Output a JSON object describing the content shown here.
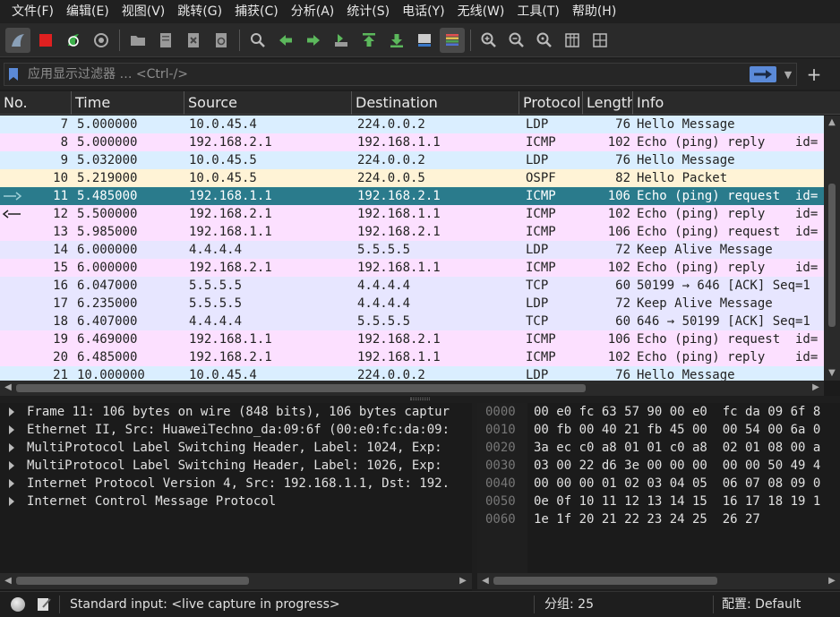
{
  "menu": [
    "文件(F)",
    "编辑(E)",
    "视图(V)",
    "跳转(G)",
    "捕获(C)",
    "分析(A)",
    "统计(S)",
    "电话(Y)",
    "无线(W)",
    "工具(T)",
    "帮助(H)"
  ],
  "toolbar": {
    "icons": [
      "shark-fin-icon",
      "stop-capture-icon",
      "restart-capture-icon",
      "capture-options-icon",
      "open-file-icon",
      "save-file-icon",
      "close-file-icon",
      "reload-file-icon",
      "find-packet-icon",
      "go-back-icon",
      "go-forward-icon",
      "go-to-packet-icon",
      "go-first-icon",
      "go-last-icon",
      "auto-scroll-icon",
      "colorize-icon",
      "zoom-in-icon",
      "zoom-out-icon",
      "zoom-normal-icon",
      "resize-columns-icon",
      "layout-icon"
    ]
  },
  "filter": {
    "placeholder": "应用显示过滤器 … <Ctrl-/>",
    "add_label": "+"
  },
  "columns": [
    "No.",
    "Time",
    "Source",
    "Destination",
    "Protocol",
    "Length",
    "Info"
  ],
  "colors": {
    "udp_blue": "#daeeff",
    "icmp_pink": "#fce0ff",
    "ospf_yellow": "#fff3d6",
    "tcp_gray": "#e7e6ff",
    "selected": "#2a7b8c"
  },
  "packets": [
    {
      "no": "7",
      "time": "5.000000",
      "src": "10.0.45.4",
      "dst": "224.0.0.2",
      "proto": "LDP",
      "len": "76",
      "info": "Hello Message",
      "color": "#daeeff",
      "mark": ""
    },
    {
      "no": "8",
      "time": "5.000000",
      "src": "192.168.2.1",
      "dst": "192.168.1.1",
      "proto": "ICMP",
      "len": "102",
      "info": "Echo (ping) reply    id=",
      "color": "#fce0ff",
      "mark": ""
    },
    {
      "no": "9",
      "time": "5.032000",
      "src": "10.0.45.5",
      "dst": "224.0.0.2",
      "proto": "LDP",
      "len": "76",
      "info": "Hello Message",
      "color": "#daeeff",
      "mark": ""
    },
    {
      "no": "10",
      "time": "5.219000",
      "src": "10.0.45.5",
      "dst": "224.0.0.5",
      "proto": "OSPF",
      "len": "82",
      "info": "Hello Packet",
      "color": "#fff3d6",
      "mark": ""
    },
    {
      "no": "11",
      "time": "5.485000",
      "src": "192.168.1.1",
      "dst": "192.168.2.1",
      "proto": "ICMP",
      "len": "106",
      "info": "Echo (ping) request  id=",
      "color": "#2a7b8c",
      "mark": "request",
      "selected": true
    },
    {
      "no": "12",
      "time": "5.500000",
      "src": "192.168.2.1",
      "dst": "192.168.1.1",
      "proto": "ICMP",
      "len": "102",
      "info": "Echo (ping) reply    id=",
      "color": "#fce0ff",
      "mark": "reply"
    },
    {
      "no": "13",
      "time": "5.985000",
      "src": "192.168.1.1",
      "dst": "192.168.2.1",
      "proto": "ICMP",
      "len": "106",
      "info": "Echo (ping) request  id=",
      "color": "#fce0ff",
      "mark": ""
    },
    {
      "no": "14",
      "time": "6.000000",
      "src": "4.4.4.4",
      "dst": "5.5.5.5",
      "proto": "LDP",
      "len": "72",
      "info": "Keep Alive Message",
      "color": "#e7e6ff",
      "mark": ""
    },
    {
      "no": "15",
      "time": "6.000000",
      "src": "192.168.2.1",
      "dst": "192.168.1.1",
      "proto": "ICMP",
      "len": "102",
      "info": "Echo (ping) reply    id=",
      "color": "#fce0ff",
      "mark": ""
    },
    {
      "no": "16",
      "time": "6.047000",
      "src": "5.5.5.5",
      "dst": "4.4.4.4",
      "proto": "TCP",
      "len": "60",
      "info": "50199 → 646 [ACK] Seq=1",
      "color": "#e7e6ff",
      "mark": ""
    },
    {
      "no": "17",
      "time": "6.235000",
      "src": "5.5.5.5",
      "dst": "4.4.4.4",
      "proto": "LDP",
      "len": "72",
      "info": "Keep Alive Message",
      "color": "#e7e6ff",
      "mark": ""
    },
    {
      "no": "18",
      "time": "6.407000",
      "src": "4.4.4.4",
      "dst": "5.5.5.5",
      "proto": "TCP",
      "len": "60",
      "info": "646 → 50199 [ACK] Seq=1",
      "color": "#e7e6ff",
      "mark": ""
    },
    {
      "no": "19",
      "time": "6.469000",
      "src": "192.168.1.1",
      "dst": "192.168.2.1",
      "proto": "ICMP",
      "len": "106",
      "info": "Echo (ping) request  id=",
      "color": "#fce0ff",
      "mark": ""
    },
    {
      "no": "20",
      "time": "6.485000",
      "src": "192.168.2.1",
      "dst": "192.168.1.1",
      "proto": "ICMP",
      "len": "102",
      "info": "Echo (ping) reply    id=",
      "color": "#fce0ff",
      "mark": ""
    },
    {
      "no": "21",
      "time": "10.000000",
      "src": "10.0.45.4",
      "dst": "224.0.0.2",
      "proto": "LDP",
      "len": "76",
      "info": "Hello Message",
      "color": "#daeeff",
      "mark": ""
    }
  ],
  "details": [
    "Frame 11: 106 bytes on wire (848 bits), 106 bytes captur",
    "Ethernet II, Src: HuaweiTechno_da:09:6f (00:e0:fc:da:09:",
    "MultiProtocol Label Switching Header, Label: 1024, Exp: ",
    "MultiProtocol Label Switching Header, Label: 1026, Exp: ",
    "Internet Protocol Version 4, Src: 192.168.1.1, Dst: 192.",
    "Internet Control Message Protocol"
  ],
  "bytes": [
    {
      "offset": "0000",
      "hex": "00 e0 fc 63 57 90 00 e0  fc da 09 6f 8"
    },
    {
      "offset": "0010",
      "hex": "00 fb 00 40 21 fb 45 00  00 54 00 6a 0"
    },
    {
      "offset": "0020",
      "hex": "3a ec c0 a8 01 01 c0 a8  02 01 08 00 a"
    },
    {
      "offset": "0030",
      "hex": "03 00 22 d6 3e 00 00 00  00 00 50 49 4"
    },
    {
      "offset": "0040",
      "hex": "00 00 00 01 02 03 04 05  06 07 08 09 0"
    },
    {
      "offset": "0050",
      "hex": "0e 0f 10 11 12 13 14 15  16 17 18 19 1"
    },
    {
      "offset": "0060",
      "hex": "1e 1f 20 21 22 23 24 25  26 27"
    }
  ],
  "status": {
    "capture": "Standard input: <live capture in progress>",
    "packets": "分组: 25",
    "profile": "配置: Default"
  }
}
